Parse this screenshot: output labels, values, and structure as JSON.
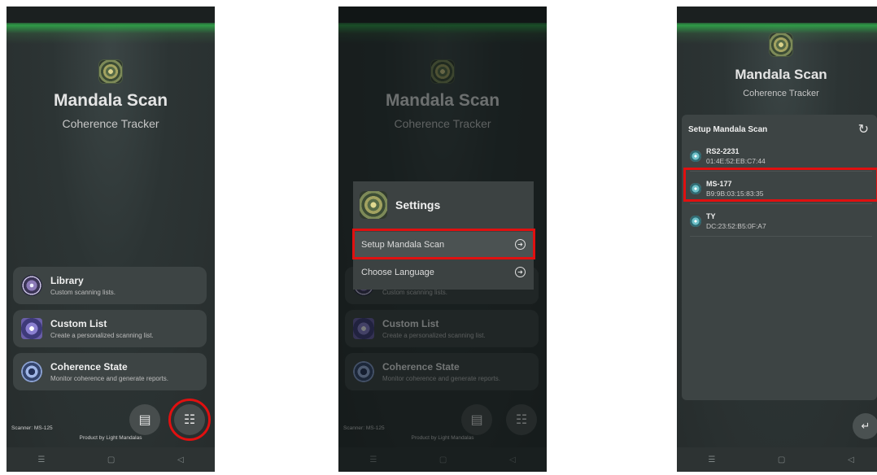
{
  "app": {
    "title": "Mandala Scan",
    "subtitle": "Coherence Tracker",
    "scanner_label": "Scanner: MS-125",
    "product_label": "Product by Light Mandalas"
  },
  "cards": [
    {
      "title": "Library",
      "desc": "Custom scanning lists."
    },
    {
      "title": "Custom List",
      "desc": "Create a personalized scanning list."
    },
    {
      "title": "Coherence State",
      "desc": "Monitor coherence and generate reports."
    }
  ],
  "icons": {
    "store": "store-icon",
    "settings": "sliders-icon",
    "store_glyph": "▤",
    "settings_glyph": "☷",
    "arrow_glyph": "➜",
    "refresh_glyph": "↻",
    "back_glyph": "↵",
    "nav_menu": "☰",
    "nav_home": "▢",
    "nav_back": "◁"
  },
  "settings_dialog": {
    "title": "Settings",
    "items": [
      {
        "label": "Setup Mandala Scan"
      },
      {
        "label": "Choose Language"
      }
    ]
  },
  "device_panel": {
    "title": "Setup Mandala Scan",
    "devices": [
      {
        "name": "RS2-2231",
        "mac": "01:4E:52:EB:C7:44"
      },
      {
        "name": "MS-177",
        "mac": "B9:9B:03:15:83:35"
      },
      {
        "name": "TY",
        "mac": "DC:23:52:B5:0F:A7"
      }
    ]
  },
  "colors": {
    "highlight": "#e01010",
    "card_bg": "#3d4444",
    "glow": "#2f9a47"
  }
}
